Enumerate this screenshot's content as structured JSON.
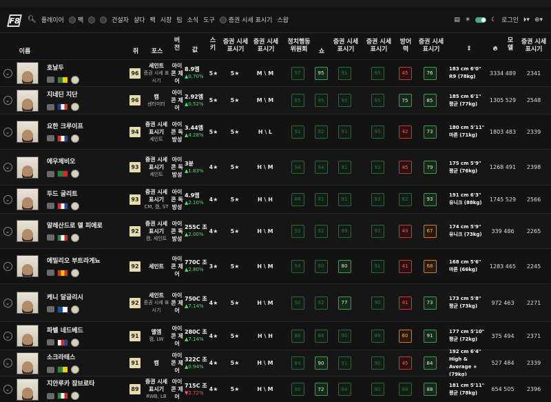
{
  "nav": {
    "logo": "F8",
    "items": [
      "플레이어",
      "팩",
      "",
      "",
      "건설자",
      "샬다",
      "팩",
      "시장",
      "팀",
      "소식",
      "도구",
      "증권 시세 표시기",
      "스왑"
    ],
    "right": [
      "로그인"
    ]
  },
  "headers": {
    "name": "이름",
    "ovr": "쥐",
    "pos": "포스",
    "ver": "버전",
    "price": "값",
    "sm": "스키",
    "wf": "증권 시세 표시기",
    "wr": "증권 시세 표시기",
    "s1": "정치행동 위원회",
    "s2": "쇼",
    "s3": "증권 시세 표시기",
    "s4": "증권 시세 표시기",
    "s5": "방어력",
    "s6": "증권 시세 표시기",
    "pop": "모델",
    "igs": "증권 시세 표시기"
  },
  "players": [
    {
      "name": "호날두",
      "ovr": "96",
      "pos": "세인트",
      "pos2": "증권 시세 표시기",
      "ver": "아이콘 제어",
      "price": "8.9엠",
      "change": "▲0.70%",
      "neg": false,
      "sm": "5★",
      "wf": "5★",
      "wr": "M \\ M",
      "stats": [
        "97",
        "95",
        "91",
        "95",
        "45",
        "76"
      ],
      "height": "183 cm 6'0\"",
      "build": "R9 (78kg)",
      "pop": "3334 489",
      "igs": "2341"
    },
    {
      "name": "지네딘 지단",
      "ovr": "96",
      "pos": "캠",
      "pos2": "센터미터",
      "ver": "아이콘 제어",
      "price": "2.92엠",
      "change": "▲0.52%",
      "neg": false,
      "sm": "5★",
      "wf": "5★",
      "wr": "M \\ M",
      "stats": [
        "85",
        "95",
        "95",
        "95",
        "75",
        "85"
      ],
      "height": "185 cm 6'1\"",
      "build": "평균 (77kg)",
      "pop": "1305 529",
      "igs": "2548"
    },
    {
      "name": "요한 크루이프",
      "ovr": "94",
      "pos": "증권 시세 표시기",
      "pos2": "세인트",
      "ver": "아이콘 독방성",
      "price": "3.44엠",
      "change": "▲4.28%",
      "neg": false,
      "sm": "5★",
      "wf": "5★",
      "wr": "H \\ L",
      "stats": [
        "91",
        "92",
        "91",
        "95",
        "42",
        "73"
      ],
      "height": "180 cm 5'11\"",
      "build": "마른 (71kg)",
      "pop": "1803 483",
      "igs": "2339"
    },
    {
      "name": "에우제비오",
      "ovr": "93",
      "pos": "증권 시세 표시기",
      "pos2": "세인트",
      "ver": "아이콘 독방성",
      "price": "3분",
      "change": "▲1.83%",
      "neg": false,
      "sm": "4★",
      "wf": "5★",
      "wr": "H \\ M",
      "stats": [
        "94",
        "94",
        "91",
        "93",
        "45",
        "79"
      ],
      "height": "175 cm 5'9\"",
      "build": "평균 (76kg)",
      "pop": "1268 491",
      "igs": "2398"
    },
    {
      "name": "두드 굴리트",
      "ovr": "93",
      "pos": "증권 시세 표시기",
      "pos2": "CM, 캠, ST",
      "ver": "아이콘 독방성",
      "price": "4.9엠",
      "change": "▲2.10%",
      "neg": false,
      "sm": "4★",
      "wf": "5★",
      "wr": "H \\ H",
      "stats": [
        "88",
        "91",
        "91",
        "93",
        "82",
        "93"
      ],
      "height": "191 cm 6'3\"",
      "build": "유니크 (88kg)",
      "pop": "1745 529",
      "igs": "2566"
    },
    {
      "name": "알레산드로 델 피에로",
      "ovr": "92",
      "pos": "증권 시세 표시기",
      "pos2": "캠, 세인트",
      "ver": "아이콘 독방성",
      "price": "255C 조",
      "change": "▲2.00%",
      "neg": false,
      "sm": "4★",
      "wf": "5★",
      "wr": "H \\ M",
      "stats": [
        "93",
        "92",
        "89",
        "92",
        "43",
        "67"
      ],
      "height": "174 cm 5'9\"",
      "build": "유니크 (73kg)",
      "pop": "339 486",
      "igs": "2265"
    },
    {
      "name": "에밀리오 부트라게뇨",
      "ovr": "92",
      "pos": "세인트",
      "pos2": "",
      "ver": "아이콘 제어",
      "price": "770C 조",
      "change": "▲2.80%",
      "neg": false,
      "sm": "3★",
      "wf": "5★",
      "wr": "H \\ M",
      "stats": [
        "94",
        "90",
        "80",
        "91",
        "41",
        "68"
      ],
      "height": "168 cm 5'6\"",
      "build": "마른 (66kg)",
      "pop": "1283 465",
      "igs": "2245"
    },
    {
      "name": "케니 달글리시",
      "ovr": "92",
      "pos": "세인트",
      "pos2": "증권 시세 표시기",
      "ver": "아이콘 제어",
      "price": "750C 조",
      "change": "▲7.14%",
      "neg": false,
      "sm": "4★",
      "wf": "5★",
      "wr": "H \\ M",
      "stats": [
        "90",
        "92",
        "77",
        "90",
        "41",
        "73"
      ],
      "height": "173 cm 5'8\"",
      "build": "평균 (73kg)",
      "pop": "972 463",
      "igs": "2271"
    },
    {
      "name": "파벨 네드베드",
      "ovr": "91",
      "pos": "엘엠",
      "pos2": "캠, LW",
      "ver": "아이콘 제어",
      "price": "280C 조",
      "change": "▲7.14%",
      "neg": false,
      "sm": "4★",
      "wf": "5★",
      "wr": "H \\ H",
      "stats": [
        "86",
        "88",
        "90",
        "89",
        "60",
        "91"
      ],
      "height": "177 cm 5'10\"",
      "build": "평균 (72kg)",
      "pop": "375 494",
      "igs": "2371"
    },
    {
      "name": "소크라테스",
      "ovr": "91",
      "pos": "캠",
      "pos2": "",
      "ver": "아이콘 제어",
      "price": "322C 조",
      "change": "▲0.94%",
      "neg": false,
      "sm": "4★",
      "wf": "5★",
      "wr": "H \\ M",
      "stats": [
        "84",
        "90",
        "91",
        "90",
        "45",
        "84"
      ],
      "height": "192 cm 6'4\"",
      "build": "High & Average + (79kg)",
      "pop": "527 484",
      "igs": "2339"
    },
    {
      "name": "지안루카 잠브로타",
      "ovr": "89",
      "pos": "증권 시세 표시기",
      "pos2": "RWB, LB",
      "ver": "아이콘 제어",
      "price": "715C 조",
      "change": "▼2.72%",
      "neg": true,
      "sm": "4★",
      "wf": "5★",
      "wr": "H \\ M",
      "stats": [
        "90",
        "72",
        "84",
        "90",
        "88",
        "88"
      ],
      "height": "181 cm 5'11\"",
      "build": "평균 (78kg)",
      "pop": "654 505",
      "igs": "2396"
    }
  ],
  "flags": [
    [
      "#3b7d3b",
      "#f2d000"
    ],
    [
      "#1a3a94",
      "#ffffff",
      "#e23030"
    ],
    [
      "#d03232",
      "#ffffff",
      "#2a4aa0"
    ],
    [
      "#2b7d3a",
      "#d8282a"
    ],
    [
      "#d03232",
      "#ffffff",
      "#2a4aa0"
    ],
    [
      "#2b8a3e",
      "#ffffff",
      "#d8282a"
    ],
    [
      "#d03232",
      "#f2c600",
      "#d03232"
    ],
    [
      "#1d4fa3",
      "#ffffff"
    ],
    [
      "#ffffff",
      "#d12b2b",
      "#1d4a9b"
    ],
    [
      "#3b7d3b",
      "#f2d000"
    ],
    [
      "#2b8a3e",
      "#ffffff",
      "#d8282a"
    ]
  ],
  "stat_styles": [
    [
      "",
      "hi",
      "",
      "",
      "red",
      "hi"
    ],
    [
      "",
      "",
      "",
      "",
      "hi",
      "hi"
    ],
    [
      "",
      "",
      "",
      "",
      "red",
      "hi"
    ],
    [
      "",
      "",
      "",
      "",
      "red",
      "hi"
    ],
    [
      "",
      "",
      "",
      "",
      "",
      "hi"
    ],
    [
      "",
      "",
      "",
      "",
      "red",
      "org"
    ],
    [
      "",
      "",
      "hi",
      "",
      "red",
      "org"
    ],
    [
      "",
      "",
      "hi",
      "",
      "red",
      "hi"
    ],
    [
      "",
      "",
      "",
      "",
      "org",
      "hi"
    ],
    [
      "",
      "hi",
      "",
      "",
      "red",
      "hi"
    ],
    [
      "",
      "hi",
      "",
      "",
      "",
      "hi"
    ]
  ]
}
